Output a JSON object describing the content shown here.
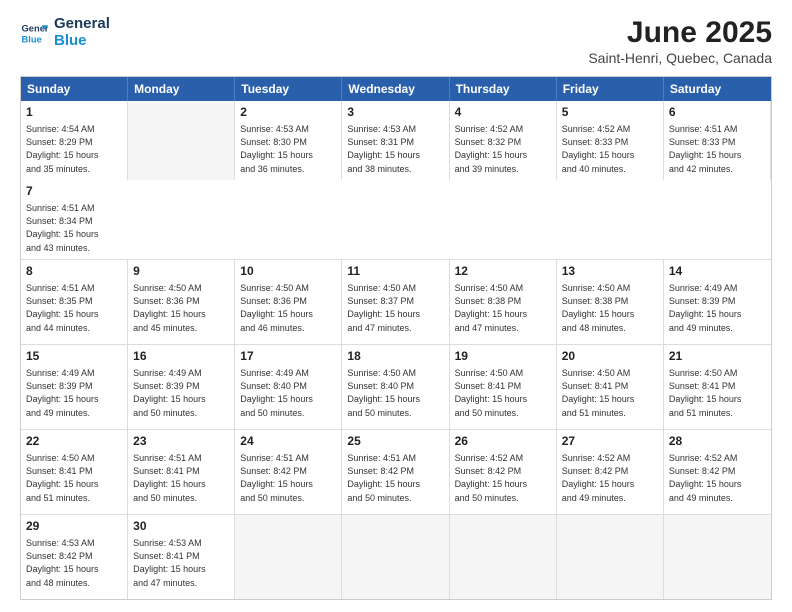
{
  "header": {
    "logo_line1": "General",
    "logo_line2": "Blue",
    "title": "June 2025",
    "subtitle": "Saint-Henri, Quebec, Canada"
  },
  "calendar": {
    "days_of_week": [
      "Sunday",
      "Monday",
      "Tuesday",
      "Wednesday",
      "Thursday",
      "Friday",
      "Saturday"
    ],
    "weeks": [
      [
        {
          "day": "",
          "empty": true,
          "lines": []
        },
        {
          "day": "2",
          "empty": false,
          "lines": [
            "Sunrise: 4:53 AM",
            "Sunset: 8:30 PM",
            "Daylight: 15 hours",
            "and 36 minutes."
          ]
        },
        {
          "day": "3",
          "empty": false,
          "lines": [
            "Sunrise: 4:53 AM",
            "Sunset: 8:31 PM",
            "Daylight: 15 hours",
            "and 38 minutes."
          ]
        },
        {
          "day": "4",
          "empty": false,
          "lines": [
            "Sunrise: 4:52 AM",
            "Sunset: 8:32 PM",
            "Daylight: 15 hours",
            "and 39 minutes."
          ]
        },
        {
          "day": "5",
          "empty": false,
          "lines": [
            "Sunrise: 4:52 AM",
            "Sunset: 8:33 PM",
            "Daylight: 15 hours",
            "and 40 minutes."
          ]
        },
        {
          "day": "6",
          "empty": false,
          "lines": [
            "Sunrise: 4:51 AM",
            "Sunset: 8:33 PM",
            "Daylight: 15 hours",
            "and 42 minutes."
          ]
        },
        {
          "day": "7",
          "empty": false,
          "lines": [
            "Sunrise: 4:51 AM",
            "Sunset: 8:34 PM",
            "Daylight: 15 hours",
            "and 43 minutes."
          ]
        }
      ],
      [
        {
          "day": "8",
          "empty": false,
          "lines": [
            "Sunrise: 4:51 AM",
            "Sunset: 8:35 PM",
            "Daylight: 15 hours",
            "and 44 minutes."
          ]
        },
        {
          "day": "9",
          "empty": false,
          "lines": [
            "Sunrise: 4:50 AM",
            "Sunset: 8:36 PM",
            "Daylight: 15 hours",
            "and 45 minutes."
          ]
        },
        {
          "day": "10",
          "empty": false,
          "lines": [
            "Sunrise: 4:50 AM",
            "Sunset: 8:36 PM",
            "Daylight: 15 hours",
            "and 46 minutes."
          ]
        },
        {
          "day": "11",
          "empty": false,
          "lines": [
            "Sunrise: 4:50 AM",
            "Sunset: 8:37 PM",
            "Daylight: 15 hours",
            "and 47 minutes."
          ]
        },
        {
          "day": "12",
          "empty": false,
          "lines": [
            "Sunrise: 4:50 AM",
            "Sunset: 8:38 PM",
            "Daylight: 15 hours",
            "and 47 minutes."
          ]
        },
        {
          "day": "13",
          "empty": false,
          "lines": [
            "Sunrise: 4:50 AM",
            "Sunset: 8:38 PM",
            "Daylight: 15 hours",
            "and 48 minutes."
          ]
        },
        {
          "day": "14",
          "empty": false,
          "lines": [
            "Sunrise: 4:49 AM",
            "Sunset: 8:39 PM",
            "Daylight: 15 hours",
            "and 49 minutes."
          ]
        }
      ],
      [
        {
          "day": "15",
          "empty": false,
          "lines": [
            "Sunrise: 4:49 AM",
            "Sunset: 8:39 PM",
            "Daylight: 15 hours",
            "and 49 minutes."
          ]
        },
        {
          "day": "16",
          "empty": false,
          "lines": [
            "Sunrise: 4:49 AM",
            "Sunset: 8:39 PM",
            "Daylight: 15 hours",
            "and 50 minutes."
          ]
        },
        {
          "day": "17",
          "empty": false,
          "lines": [
            "Sunrise: 4:49 AM",
            "Sunset: 8:40 PM",
            "Daylight: 15 hours",
            "and 50 minutes."
          ]
        },
        {
          "day": "18",
          "empty": false,
          "lines": [
            "Sunrise: 4:50 AM",
            "Sunset: 8:40 PM",
            "Daylight: 15 hours",
            "and 50 minutes."
          ]
        },
        {
          "day": "19",
          "empty": false,
          "lines": [
            "Sunrise: 4:50 AM",
            "Sunset: 8:41 PM",
            "Daylight: 15 hours",
            "and 50 minutes."
          ]
        },
        {
          "day": "20",
          "empty": false,
          "lines": [
            "Sunrise: 4:50 AM",
            "Sunset: 8:41 PM",
            "Daylight: 15 hours",
            "and 51 minutes."
          ]
        },
        {
          "day": "21",
          "empty": false,
          "lines": [
            "Sunrise: 4:50 AM",
            "Sunset: 8:41 PM",
            "Daylight: 15 hours",
            "and 51 minutes."
          ]
        }
      ],
      [
        {
          "day": "22",
          "empty": false,
          "lines": [
            "Sunrise: 4:50 AM",
            "Sunset: 8:41 PM",
            "Daylight: 15 hours",
            "and 51 minutes."
          ]
        },
        {
          "day": "23",
          "empty": false,
          "lines": [
            "Sunrise: 4:51 AM",
            "Sunset: 8:41 PM",
            "Daylight: 15 hours",
            "and 50 minutes."
          ]
        },
        {
          "day": "24",
          "empty": false,
          "lines": [
            "Sunrise: 4:51 AM",
            "Sunset: 8:42 PM",
            "Daylight: 15 hours",
            "and 50 minutes."
          ]
        },
        {
          "day": "25",
          "empty": false,
          "lines": [
            "Sunrise: 4:51 AM",
            "Sunset: 8:42 PM",
            "Daylight: 15 hours",
            "and 50 minutes."
          ]
        },
        {
          "day": "26",
          "empty": false,
          "lines": [
            "Sunrise: 4:52 AM",
            "Sunset: 8:42 PM",
            "Daylight: 15 hours",
            "and 50 minutes."
          ]
        },
        {
          "day": "27",
          "empty": false,
          "lines": [
            "Sunrise: 4:52 AM",
            "Sunset: 8:42 PM",
            "Daylight: 15 hours",
            "and 49 minutes."
          ]
        },
        {
          "day": "28",
          "empty": false,
          "lines": [
            "Sunrise: 4:52 AM",
            "Sunset: 8:42 PM",
            "Daylight: 15 hours",
            "and 49 minutes."
          ]
        }
      ],
      [
        {
          "day": "29",
          "empty": false,
          "lines": [
            "Sunrise: 4:53 AM",
            "Sunset: 8:42 PM",
            "Daylight: 15 hours",
            "and 48 minutes."
          ]
        },
        {
          "day": "30",
          "empty": false,
          "lines": [
            "Sunrise: 4:53 AM",
            "Sunset: 8:41 PM",
            "Daylight: 15 hours",
            "and 47 minutes."
          ]
        },
        {
          "day": "",
          "empty": true,
          "lines": []
        },
        {
          "day": "",
          "empty": true,
          "lines": []
        },
        {
          "day": "",
          "empty": true,
          "lines": []
        },
        {
          "day": "",
          "empty": true,
          "lines": []
        },
        {
          "day": "",
          "empty": true,
          "lines": []
        }
      ]
    ],
    "week0_day1": {
      "day": "1",
      "lines": [
        "Sunrise: 4:54 AM",
        "Sunset: 8:29 PM",
        "Daylight: 15 hours",
        "and 35 minutes."
      ]
    }
  }
}
